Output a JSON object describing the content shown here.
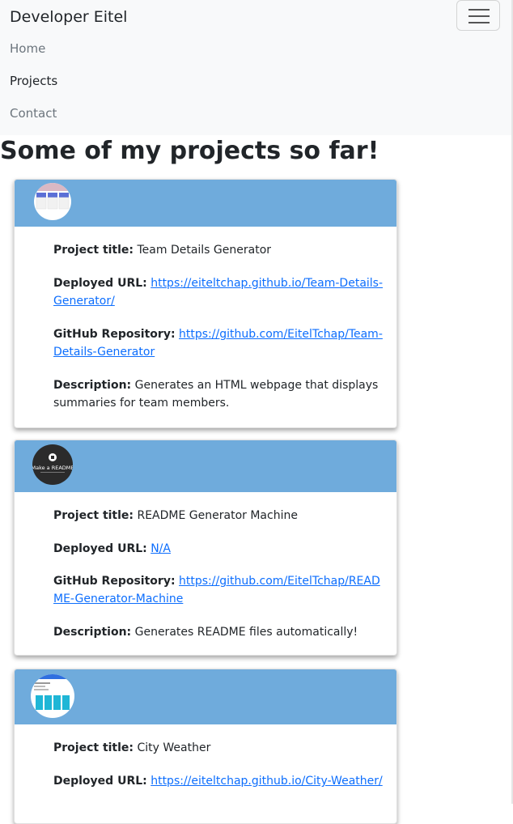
{
  "nav": {
    "brand": "Developer Eitel",
    "links": [
      "Home",
      "Projects",
      "Contact"
    ],
    "active": "Projects"
  },
  "page": {
    "heading": "Some of my projects so far!"
  },
  "labels": {
    "title": "Project title:",
    "deployed": "Deployed URL:",
    "repo": "GitHub Repository:",
    "description": "Description:"
  },
  "projects": [
    {
      "title": "Team Details Generator",
      "deployed": "https://eiteltchap.github.io/Team-Details-Generator/",
      "repo": "https://github.com/EitelTchap/Team-Details-Generator",
      "description": "Generates an HTML webpage that displays summaries for team members."
    },
    {
      "title": "README Generator Machine",
      "deployed": "N/A",
      "repo": "https://github.com/EitelTchap/README-Generator-Machine",
      "description": "Generates README files automatically!",
      "thumb_text": "Make a README"
    },
    {
      "title": "City Weather",
      "deployed": "https://eiteltchap.github.io/City-Weather/"
    }
  ],
  "colors": {
    "navbar_bg": "#f8f9fa",
    "card_header": "#6fabdc",
    "link": "#0d6efd"
  }
}
